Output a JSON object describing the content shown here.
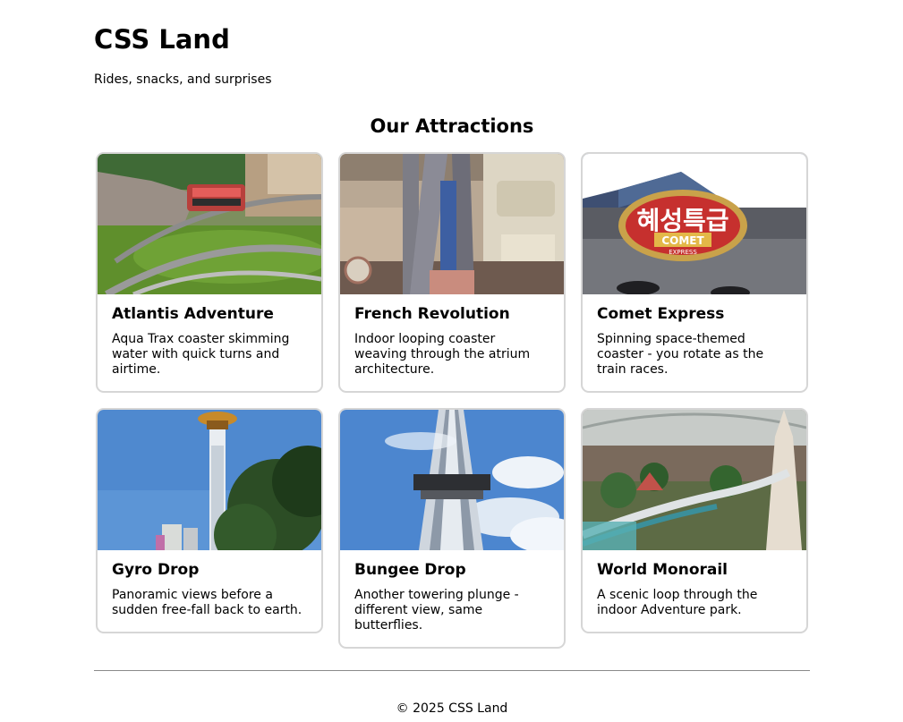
{
  "header": {
    "title": "CSS Land",
    "tagline": "Rides, snacks, and surprises"
  },
  "attractions": {
    "heading": "Our Attractions",
    "items": [
      {
        "title": "Atlantis Adventure",
        "description": "Aqua Trax coaster skimming water with quick turns and airtime."
      },
      {
        "title": "French Revolution",
        "description": "Indoor looping coaster weaving through the atrium architecture."
      },
      {
        "title": "Comet Express",
        "description": "Spinning space-themed coaster - you rotate as the train races.",
        "sign_text": "혜성특급",
        "sign_sub": "COMET",
        "sign_sub2": "EXPRESS"
      },
      {
        "title": "Gyro Drop",
        "description": "Panoramic views before a sudden free-fall back to earth."
      },
      {
        "title": "Bungee Drop",
        "description": "Another towering plunge - different view, same butterflies."
      },
      {
        "title": "World Monorail",
        "description": "A scenic loop through the indoor Adventure park."
      }
    ]
  },
  "footer": {
    "copyright": "© 2025 CSS Land"
  }
}
